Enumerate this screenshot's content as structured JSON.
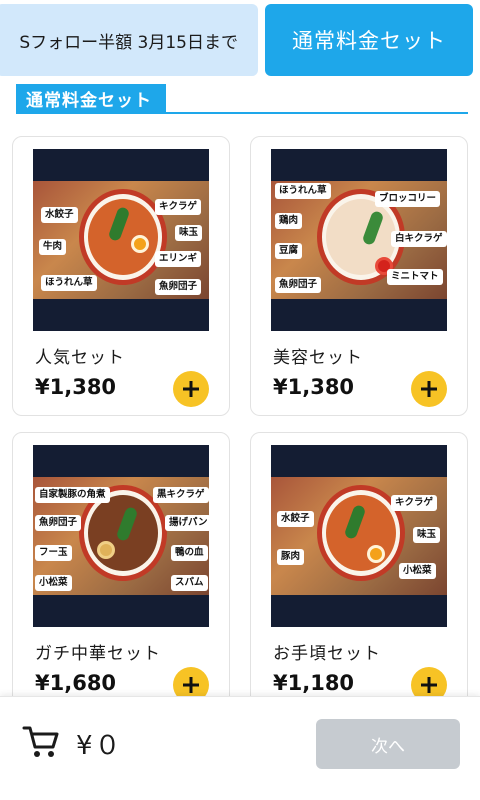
{
  "tabs": {
    "promo_label": "Sフォロー半額 3月15日まで",
    "regular_label": "通常料金セット"
  },
  "section": {
    "title": "通常料金セット"
  },
  "colors": {
    "accent": "#1ea7ea",
    "add_button": "#f7c325",
    "next_disabled": "#c6cbd0"
  },
  "products": [
    {
      "name": "人気セット",
      "price": "¥1,380",
      "tags": [
        "キクラゲ",
        "水餃子",
        "味玉",
        "牛肉",
        "エリンギ",
        "ほうれん草",
        "魚卵団子"
      ]
    },
    {
      "name": "美容セット",
      "price": "¥1,380",
      "tags": [
        "ほうれん草",
        "ブロッコリー",
        "鶏肉",
        "白キクラゲ",
        "豆腐",
        "ミニトマト",
        "魚卵団子"
      ]
    },
    {
      "name": "ガチ中華セット",
      "price": "¥1,680",
      "tags": [
        "自家製豚の角煮",
        "黒キクラゲ",
        "魚卵団子",
        "揚げパン",
        "フー玉",
        "鴨の血",
        "小松菜",
        "スパム"
      ]
    },
    {
      "name": "お手頃セット",
      "price": "¥1,180",
      "tags": [
        "キクラゲ",
        "水餃子",
        "味玉",
        "豚肉",
        "小松菜"
      ]
    }
  ],
  "cart": {
    "total": "¥０",
    "icon": "cart-icon"
  },
  "next_button": {
    "label": "次へ"
  }
}
